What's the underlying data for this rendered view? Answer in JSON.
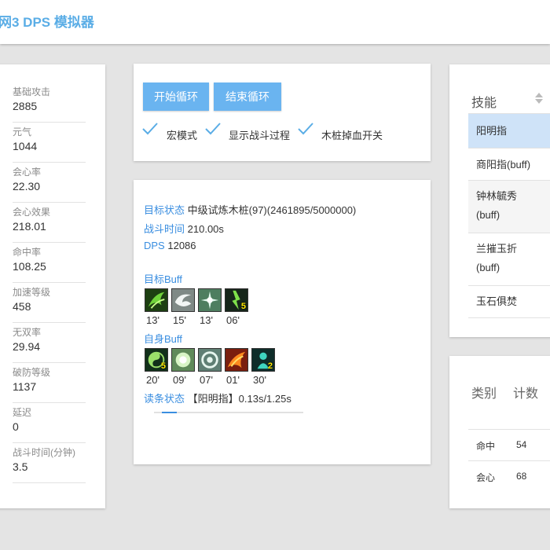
{
  "app": {
    "title": "网3 DPS 模拟器"
  },
  "stats": [
    {
      "label": "基础攻击",
      "value": "2885"
    },
    {
      "label": "元气",
      "value": "1044"
    },
    {
      "label": "会心率",
      "value": "22.30"
    },
    {
      "label": "会心效果",
      "value": "218.01"
    },
    {
      "label": "命中率",
      "value": "108.25"
    },
    {
      "label": "加速等级",
      "value": "458"
    },
    {
      "label": "无双率",
      "value": "29.94"
    },
    {
      "label": "破防等级",
      "value": "1137"
    },
    {
      "label": "延迟",
      "value": "0"
    },
    {
      "label": "战斗时间(分钟)",
      "value": "3.5"
    }
  ],
  "controls": {
    "start_label": "开始循环",
    "stop_label": "结束循环",
    "options": [
      {
        "label": "宏模式",
        "checked": true
      },
      {
        "label": "显示战斗过程",
        "checked": true
      },
      {
        "label": "木桩掉血开关",
        "checked": true
      }
    ]
  },
  "status": {
    "target_key": "目标状态",
    "target_value": "中级试炼木桩(97)(2461895/5000000)",
    "time_key": "战斗时间",
    "time_value": "210.00s",
    "dps_key": "DPS",
    "dps_value": "12086",
    "target_buff_title": "目标Buff",
    "target_buffs": [
      {
        "icon": "green-claw-icon",
        "time": "13'",
        "stacks": ""
      },
      {
        "icon": "white-swirl-icon",
        "time": "15'",
        "stacks": ""
      },
      {
        "icon": "frost-burst-icon",
        "time": "13'",
        "stacks": ""
      },
      {
        "icon": "dark-lightning-icon",
        "time": "06'",
        "stacks": "5"
      }
    ],
    "self_buff_title": "自身Buff",
    "self_buffs": [
      {
        "icon": "taiji-icon",
        "time": "20'",
        "stacks": "5"
      },
      {
        "icon": "green-orb-icon",
        "time": "09'",
        "stacks": ""
      },
      {
        "icon": "ring-icon",
        "time": "07'",
        "stacks": ""
      },
      {
        "icon": "fire-wing-icon",
        "time": "01'",
        "stacks": ""
      },
      {
        "icon": "teal-figure-icon",
        "time": "30'",
        "stacks": "2"
      }
    ],
    "cast_key": "读条状态",
    "cast_value": "【阳明指】0.13s/1.25s",
    "cast_progress": 0.104
  },
  "skills": {
    "header": "技能",
    "rows": [
      "阳明指",
      "商阳指(buff)",
      "钟林毓秀(buff)",
      "兰摧玉折(buff)",
      "玉石俱焚"
    ],
    "selected_index": 0
  },
  "counts": {
    "headers": [
      "类别",
      "计数"
    ],
    "rows": [
      {
        "category": "命中",
        "count": "54"
      },
      {
        "category": "会心",
        "count": "68"
      }
    ]
  },
  "colors": {
    "accent": "#6ab4f0",
    "link": "#3a8ee0",
    "selected_row": "#cfe3f8",
    "alt_row": "#f5f5f5"
  }
}
